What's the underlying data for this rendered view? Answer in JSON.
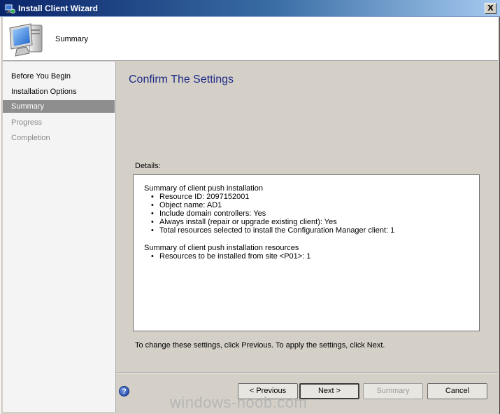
{
  "window": {
    "title": "Install Client Wizard",
    "close_label": "X"
  },
  "header": {
    "title": "Summary",
    "icon": "computer-icon"
  },
  "nav": {
    "items": [
      {
        "label": "Before You Begin",
        "state": "normal"
      },
      {
        "label": "Installation Options",
        "state": "normal"
      },
      {
        "label": "Summary",
        "state": "active"
      },
      {
        "label": "Progress",
        "state": "disabled"
      },
      {
        "label": "Completion",
        "state": "disabled"
      }
    ]
  },
  "main": {
    "title": "Confirm The Settings",
    "details_label": "Details:",
    "sections": [
      {
        "title": "Summary of client push installation",
        "bullets": [
          "Resource ID: 2097152001",
          "Object name: AD1",
          "Include domain controllers: Yes",
          "Always install (repair or upgrade existing client): Yes",
          "Total resources selected to install the Configuration Manager client:  1"
        ]
      },
      {
        "title": "Summary of client push installation resources",
        "bullets": [
          "Resources to be installed from site <P01>: 1"
        ]
      }
    ],
    "hint": "To change these settings, click Previous. To apply the settings, click Next."
  },
  "footer": {
    "help_label": "?",
    "previous_label": "< Previous",
    "next_label": "Next >",
    "summary_label": "Summary",
    "cancel_label": "Cancel"
  },
  "watermark": "windows-noob.com",
  "colors": {
    "title_text": "#1f2a86",
    "nav_active_bg": "#8e8e8e",
    "titlebar_start": "#0a246a",
    "titlebar_end": "#a6caf0"
  }
}
